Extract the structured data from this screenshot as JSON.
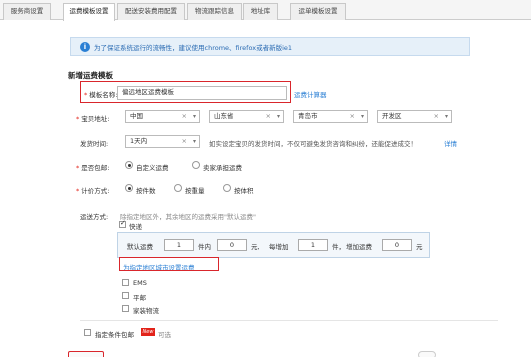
{
  "tabs": [
    {
      "label": "服务商设置",
      "active": false
    },
    {
      "label": "运费模板设置",
      "active": true
    },
    {
      "label": "配送安装费用配置",
      "active": false
    },
    {
      "label": "物流跟踪信息",
      "active": false
    },
    {
      "label": "地址库",
      "active": false
    },
    {
      "label": "运单模板设置",
      "active": false
    }
  ],
  "notice": {
    "icon": "info-icon",
    "text": "为了保证系统运行的流畅性，建议使用chrome、firefox或者新版ie1"
  },
  "section_title": "新增运费模板",
  "template_name": {
    "label": "模板名称:",
    "value": "偏远地区运费模板",
    "link": "运费计算器"
  },
  "address": {
    "label": "宝贝地址:",
    "country": "中国",
    "province": "山东省",
    "city": "青岛市",
    "district": "开发区"
  },
  "ship_time": {
    "label": "发货时间:",
    "value": "1天内",
    "note": "如实设定宝贝的发货时间，不仅可避免发货咨询和纠纷，还能促进成交！",
    "detail_link": "详情"
  },
  "free_shipping": {
    "label": "是否包邮:",
    "options": [
      "自定义运费",
      "卖家承担运费"
    ],
    "selected": "自定义运费"
  },
  "pricing": {
    "label": "计价方式:",
    "options": [
      "按件数",
      "按重量",
      "按体积"
    ],
    "selected": "按件数"
  },
  "shipping_method": {
    "label": "运送方式:",
    "hint": "除指定地区外，其余地区的运费采用\"默认运费\"",
    "express_label": "快递",
    "express_checked": true,
    "fee": {
      "default_label": "默认运费",
      "first_count": "1",
      "count_unit": "件内",
      "first_fee": "0",
      "yuan": "元,",
      "add_label": "每增加",
      "add_count": "1",
      "add_unit": "件，",
      "add_fee_label": "增加运费",
      "add_fee": "0",
      "yuan_end": "元"
    },
    "set_region_link": "为指定地区城市设置运费",
    "others": [
      {
        "label": "EMS",
        "checked": false
      },
      {
        "label": "平邮",
        "checked": false
      },
      {
        "label": "家装物流",
        "checked": false
      }
    ]
  },
  "conditional_free": {
    "label": "指定条件包邮",
    "badge": "New",
    "hint": "可选"
  },
  "colors": {
    "accent": "#2a7fd4",
    "highlight": "#d9262c",
    "required": "#e2231a"
  }
}
